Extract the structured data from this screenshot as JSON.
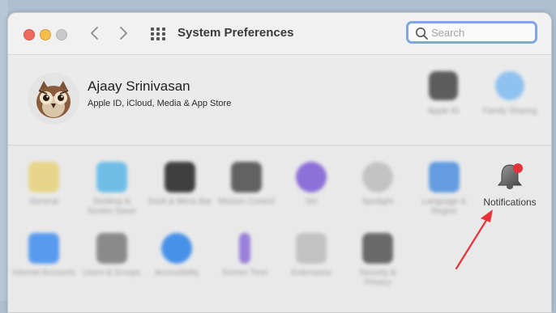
{
  "window": {
    "title": "System Preferences",
    "search_placeholder": "Search"
  },
  "account": {
    "name": "Ajaay Srinivasan",
    "subtitle": "Apple ID, iCloud, Media & App Store",
    "tiles": [
      {
        "label": "Apple ID",
        "icon": "apple-id-icon"
      },
      {
        "label": "Family Sharing",
        "icon": "family-sharing-icon"
      }
    ]
  },
  "prefs_row1": [
    {
      "label": "General",
      "icon": "general-icon",
      "color": "#e7d27a"
    },
    {
      "label": "Desktop & Screen Saver",
      "icon": "desktop-icon",
      "color": "#5bb6e8"
    },
    {
      "label": "Dock & Menu Bar",
      "icon": "dock-icon",
      "color": "#222222"
    },
    {
      "label": "Mission Control",
      "icon": "mission-control-icon",
      "color": "#4b4b4b"
    },
    {
      "label": "Siri",
      "icon": "siri-icon",
      "color": "#7d5bd6"
    },
    {
      "label": "Spotlight",
      "icon": "spotlight-icon",
      "color": "#b9b9b9"
    },
    {
      "label": "Language & Region",
      "icon": "language-icon",
      "color": "#4c8fe0"
    },
    {
      "label": "Notifications",
      "icon": "bell-icon",
      "color": "#6f6f6f"
    }
  ],
  "prefs_row2": [
    {
      "label": "Internet Accounts",
      "icon": "internet-accounts-icon",
      "color": "#3f8ef0"
    },
    {
      "label": "Users & Groups",
      "icon": "users-icon",
      "color": "#7a7a7a"
    },
    {
      "label": "Accessibility",
      "icon": "accessibility-icon",
      "color": "#2b82e8"
    },
    {
      "label": "Screen Time",
      "icon": "screen-time-icon",
      "color": "#8b6fd6"
    },
    {
      "label": "Extensions",
      "icon": "extensions-icon",
      "color": "#bcbcbc"
    },
    {
      "label": "Security & Privacy",
      "icon": "security-icon",
      "color": "#555555"
    }
  ],
  "colors": {
    "arrow": "#e8323a",
    "badge": "#e8323a",
    "search_focus": "#7ea7e0"
  }
}
